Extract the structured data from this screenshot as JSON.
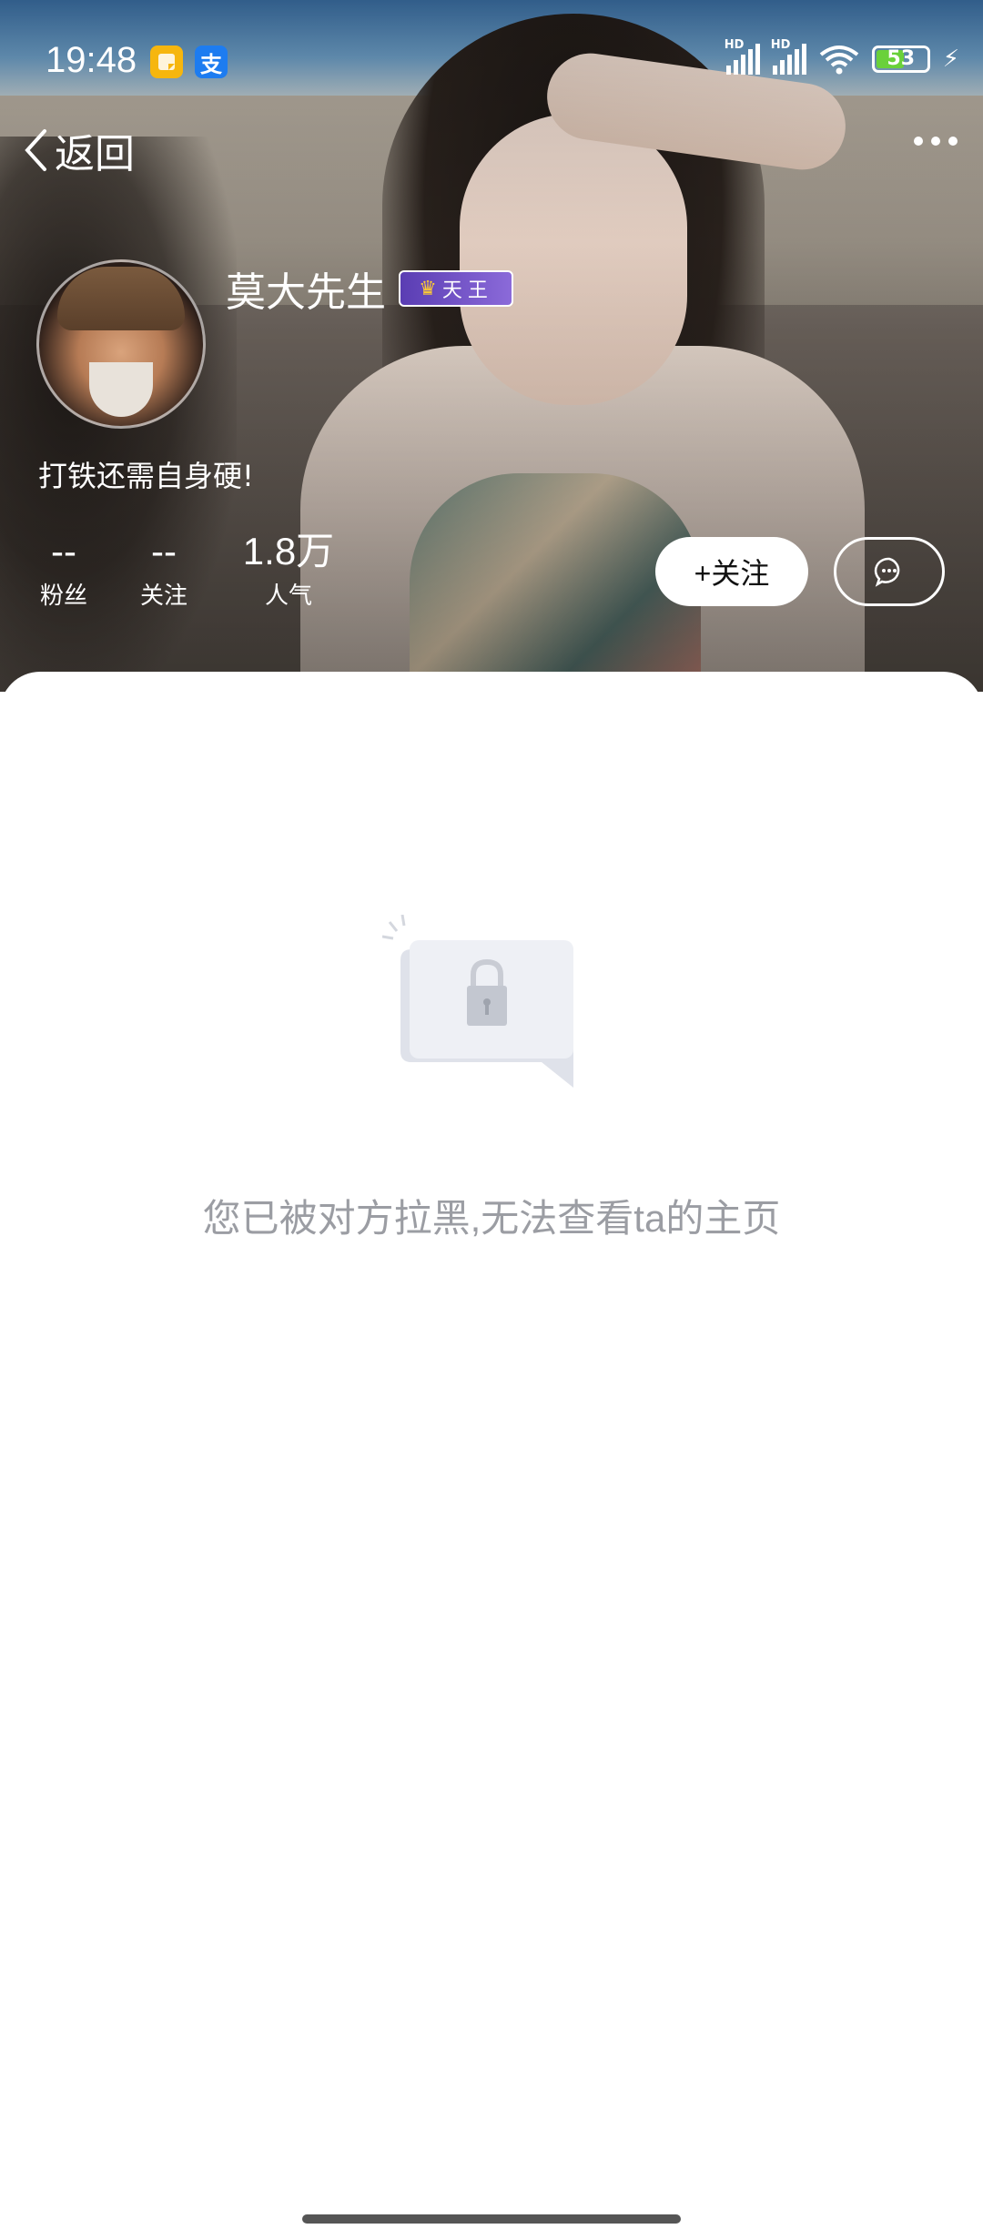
{
  "status_bar": {
    "time": "19:48",
    "app_icons": [
      "notes-app-icon",
      "alipay-icon"
    ],
    "alipay_glyph": "支",
    "signal_label_1": "HD",
    "signal_label_2": "HD",
    "battery": "53"
  },
  "nav": {
    "back_label": "返回"
  },
  "profile": {
    "name": "莫大先生",
    "badge": "天王",
    "bio": "打铁还需自身硬!",
    "stats": [
      {
        "value": "--",
        "label": "粉丝"
      },
      {
        "value": "--",
        "label": "关注"
      },
      {
        "value": "1.8万",
        "label": "人气"
      }
    ],
    "follow_button": "+关注"
  },
  "blocked": {
    "message": "您已被对方拉黑,无法查看ta的主页"
  },
  "colors": {
    "message_gray": "#9b9da3",
    "sheet_bg": "#ffffff",
    "battery_green": "#6ad13a"
  }
}
